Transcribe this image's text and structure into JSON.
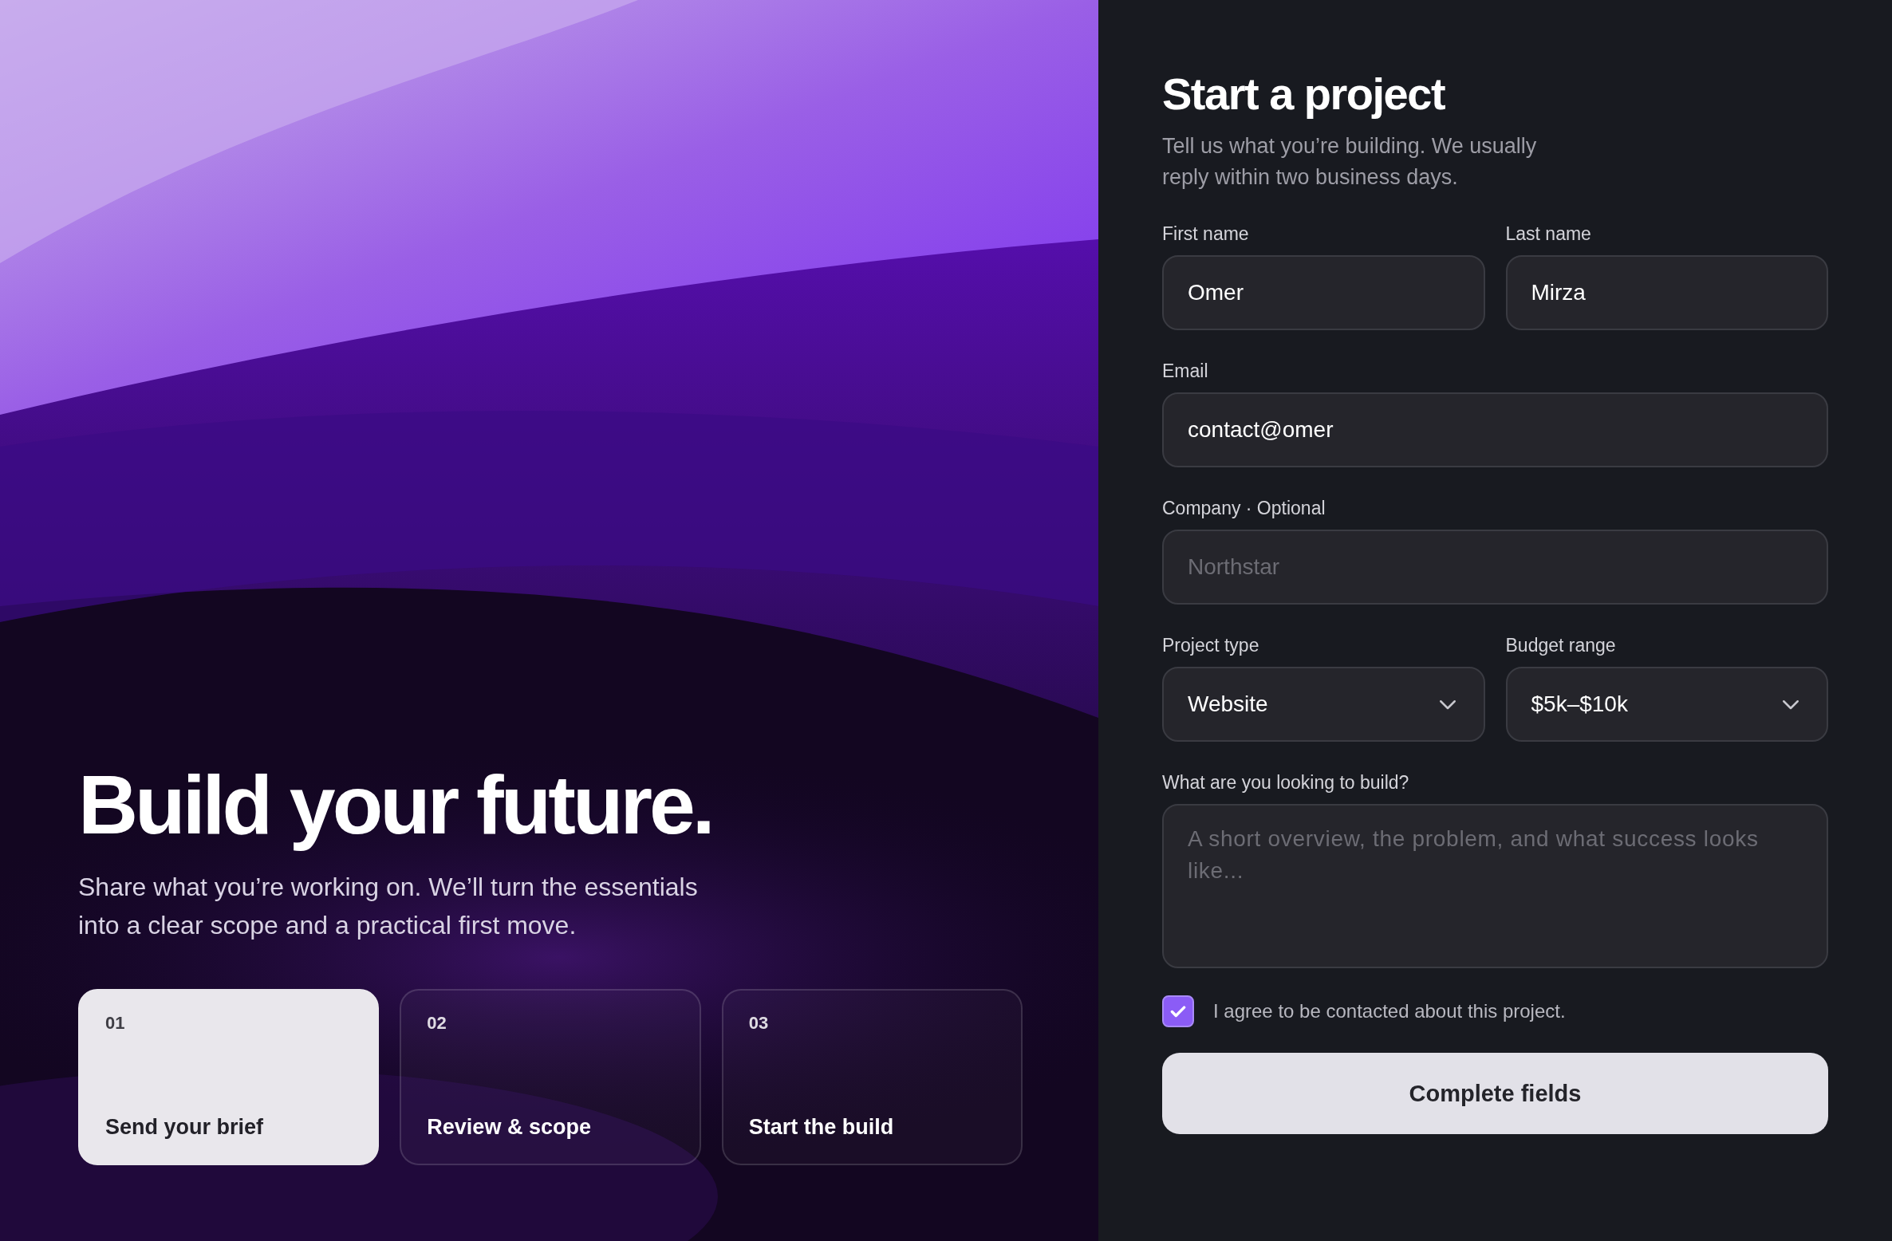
{
  "hero": {
    "title": "Build your future.",
    "subtitle": "Share what you’re working on. We’ll turn the essentials into a clear scope and a practical first move.",
    "steps": [
      {
        "number": "01",
        "label": "Send your brief",
        "selected": true
      },
      {
        "number": "02",
        "label": "Review & scope",
        "selected": false
      },
      {
        "number": "03",
        "label": "Start the build",
        "selected": false
      }
    ]
  },
  "form": {
    "title": "Start a project",
    "subtitle": "Tell us what you’re building. We usually reply within two business days.",
    "rows": [
      [
        {
          "kind": "text",
          "label": "First name",
          "value": "Omer"
        },
        {
          "kind": "text",
          "label": "Last name",
          "value": "Mirza"
        }
      ],
      [
        {
          "kind": "text",
          "label": "Email",
          "value": "contact@omer"
        }
      ],
      [
        {
          "kind": "text",
          "label": "Company · Optional",
          "placeholder": "Northstar"
        }
      ],
      [
        {
          "kind": "select",
          "label": "Project type",
          "value": "Website"
        },
        {
          "kind": "select",
          "label": "Budget range",
          "value": "$5k–$10k"
        }
      ],
      [
        {
          "kind": "textarea",
          "label": "What are you looking to build?",
          "placeholder": "A short overview, the problem, and what success looks like..."
        }
      ]
    ],
    "consent": {
      "label": "I agree to be contacted about this project.",
      "checked": true
    },
    "submit": "Complete fields"
  }
}
